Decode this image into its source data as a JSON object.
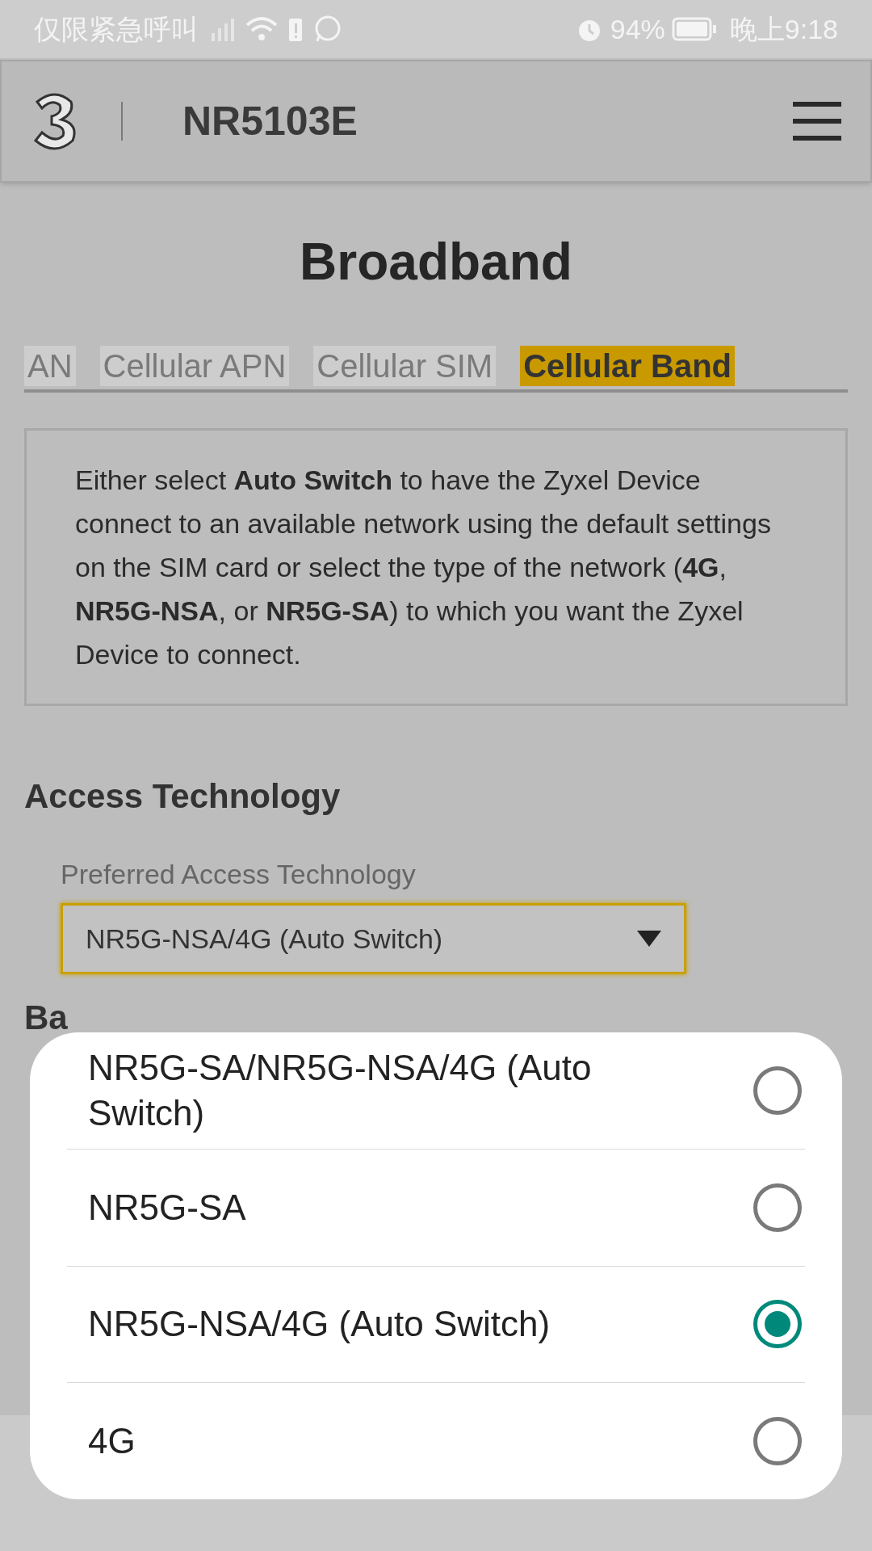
{
  "status_bar": {
    "carrier": "仅限紧急呼叫",
    "battery": "94%",
    "time": "晚上9:18"
  },
  "header": {
    "title": "NR5103E"
  },
  "page": {
    "title": "Broadband"
  },
  "tabs": [
    {
      "label": "AN",
      "selected": false
    },
    {
      "label": "Cellular APN",
      "selected": false
    },
    {
      "label": "Cellular SIM",
      "selected": false
    },
    {
      "label": "Cellular Band",
      "selected": true
    }
  ],
  "info": "Either select **Auto Switch** to have the Zyxel Device connect to an available network using the default settings on the SIM card or select the type of the network (**4G**, **NR5G-NSA**, or **NR5G-SA**) to which you want the Zyxel Device to connect.",
  "access_technology": {
    "heading": "Access Technology",
    "label": "Preferred Access Technology",
    "value": "NR5G-NSA/4G (Auto Switch)"
  },
  "band_management": {
    "heading": "Ba"
  },
  "dialog": {
    "options": [
      {
        "label": "NR5G-SA/NR5G-NSA/4G (Auto Switch)",
        "selected": false
      },
      {
        "label": "NR5G-SA",
        "selected": false
      },
      {
        "label": "NR5G-NSA/4G (Auto Switch)",
        "selected": true
      },
      {
        "label": "4G",
        "selected": false
      }
    ]
  }
}
